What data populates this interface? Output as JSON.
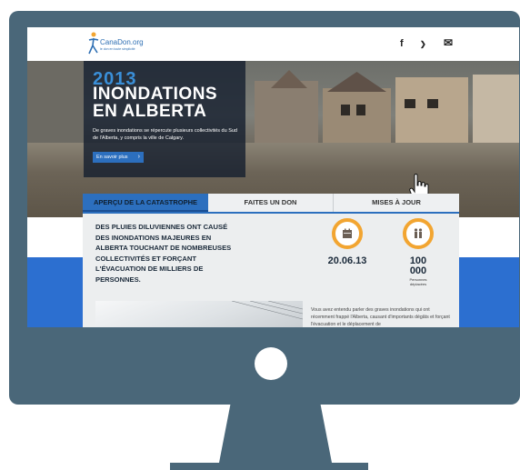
{
  "site": {
    "logo_name": "CanaDon.org",
    "logo_tagline": "le don en toute simplicité",
    "social": {
      "facebook": "f",
      "twitter": "❯",
      "email": "✉"
    }
  },
  "hero": {
    "year": "2013",
    "title_line1": "INONDATIONS",
    "title_line2": "EN ALBERTA",
    "description": "De graves inondations se répercute plusieurs collectivités du Sud de l'Alberta, y compris la ville de Calgary.",
    "button_label": "En savoir plus",
    "button_arrow": "›"
  },
  "tabs": [
    {
      "label": "APERÇU DE LA CATASTROPHE",
      "active": true
    },
    {
      "label": "FAITES UN DON",
      "active": false
    },
    {
      "label": "MISES À JOUR",
      "active": false
    }
  ],
  "overview": {
    "lead": "DES PLUIES DILUVIENNES ONT CAUSÉ DES INONDATIONS MAJEURES EN ALBERTA TOUCHANT DE NOMBREUSES COLLECTIVITÉS ET FORÇANT L'ÉVACUATION DE MILLIERS DE PERSONNES.",
    "stats": [
      {
        "icon": "calendar-icon",
        "value": "20.06.13",
        "caption": ""
      },
      {
        "icon": "people-icon",
        "value_line1": "100",
        "value_line2": "000",
        "caption_line1": "Personnes",
        "caption_line2": "déplacées"
      }
    ],
    "body": "Vous avez entendu parler des graves inondations qui ont récemment frappé l'Alberta, causant d'importants dégâts et forçant l'évacuation et le déplacement de"
  },
  "colors": {
    "monitor": "#4a6779",
    "accent_blue": "#2c6fbe",
    "band_blue": "#2c6fd0",
    "stat_ring": "#f2a531"
  }
}
